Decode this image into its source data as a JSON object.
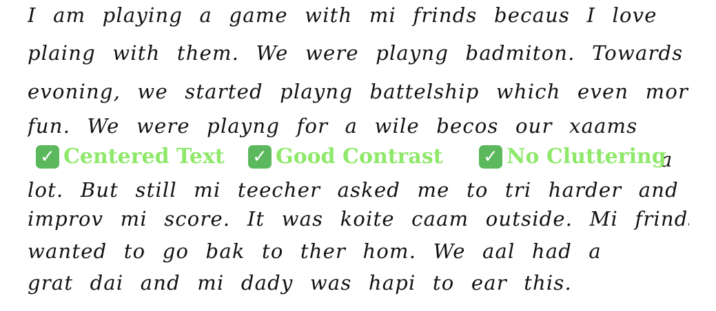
{
  "handwriting": {
    "lines": [
      "I am playing a game with mi frinds becaus I love",
      "plaing with them. We were playng badmiton. Towards",
      "evoning, we started playng battelship which even mor",
      "fun. We were playng for a wile becos our xaams",
      "a",
      "lot. But still mi teecher asked me to tri harder and",
      "improv mi score. It was koite caam outside. Mi frinds",
      "wanted to go bak to ther hom. We aal had a",
      "grat dai and mi dady was hapi to ear this."
    ]
  },
  "overlay": {
    "badges": [
      {
        "icon": "✓",
        "label": "Centered Text"
      },
      {
        "icon": "✓",
        "label": "Good Contrast"
      },
      {
        "icon": "✓",
        "label": "No Cluttering"
      }
    ],
    "color": "#8ee86a",
    "icon_bg": "#5cb85c"
  }
}
